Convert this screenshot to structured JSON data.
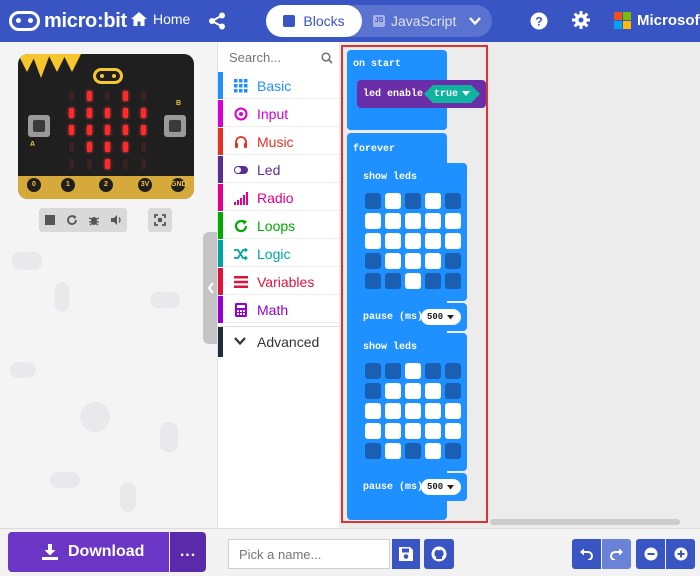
{
  "header": {
    "logo_text": "micro:bit",
    "home_label": "Home",
    "tabs": {
      "blocks_label": "Blocks",
      "javascript_label": "JavaScript"
    },
    "brand_label": "Microsoft",
    "colors": {
      "bar": "#3954c3",
      "ms_red": "#f25022",
      "ms_green": "#7fba00",
      "ms_blue": "#00a4ef",
      "ms_yellow": "#ffb900"
    }
  },
  "simulator": {
    "pin_labels": [
      "0",
      "1",
      "2",
      "3V",
      "GND"
    ],
    "button_labels": {
      "a": "A",
      "b": "B"
    },
    "controls": [
      "stop-icon",
      "restart-icon",
      "debug-icon",
      "sound-icon",
      "fullscreen-icon"
    ]
  },
  "toolbox": {
    "search_placeholder": "Search...",
    "categories": [
      {
        "label": "Basic",
        "color": "#1e90ff",
        "icon": "grid-icon"
      },
      {
        "label": "Input",
        "color": "#d400d4",
        "icon": "target-icon"
      },
      {
        "label": "Music",
        "color": "#e63022",
        "icon": "headphones-icon"
      },
      {
        "label": "Led",
        "color": "#5c2d91",
        "icon": "toggle-icon"
      },
      {
        "label": "Radio",
        "color": "#e3008c",
        "icon": "signal-icon"
      },
      {
        "label": "Loops",
        "color": "#00aa00",
        "icon": "refresh-icon"
      },
      {
        "label": "Logic",
        "color": "#00a4a6",
        "icon": "shuffle-icon"
      },
      {
        "label": "Variables",
        "color": "#dc143c",
        "icon": "list-icon"
      },
      {
        "label": "Math",
        "color": "#9400d3",
        "icon": "calculator-icon"
      }
    ],
    "advanced_label": "Advanced"
  },
  "workspace": {
    "on_start": {
      "label": "on start",
      "led_enable_label": "led enable",
      "value": "true"
    },
    "forever": {
      "label": "forever",
      "show_leds_label": "show leds",
      "pause_label": "pause (ms)",
      "frames": [
        {
          "pause": "500",
          "pattern": [
            [
              0,
              1,
              0,
              1,
              0
            ],
            [
              1,
              1,
              1,
              1,
              1
            ],
            [
              1,
              1,
              1,
              1,
              1
            ],
            [
              0,
              1,
              1,
              1,
              0
            ],
            [
              0,
              0,
              1,
              0,
              0
            ]
          ]
        },
        {
          "pause": "500",
          "pattern": [
            [
              0,
              0,
              1,
              0,
              0
            ],
            [
              0,
              1,
              1,
              1,
              0
            ],
            [
              1,
              1,
              1,
              1,
              1
            ],
            [
              1,
              1,
              1,
              1,
              1
            ],
            [
              0,
              1,
              0,
              1,
              0
            ]
          ]
        }
      ]
    }
  },
  "bottom": {
    "download_label": "Download",
    "more_label": "...",
    "name_placeholder": "Pick a name..."
  }
}
